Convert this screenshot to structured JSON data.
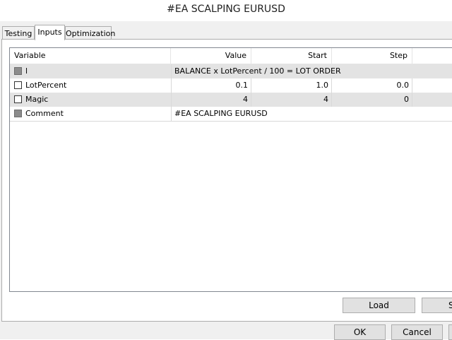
{
  "window": {
    "title": "#EA SCALPING EURUSD"
  },
  "tabs": [
    {
      "label": "Testing"
    },
    {
      "label": "Inputs",
      "active": true
    },
    {
      "label": "Optimization"
    }
  ],
  "grid": {
    "columns": [
      "Variable",
      "Value",
      "Start",
      "Step"
    ],
    "rows": [
      {
        "checked": "gray",
        "variable": "l",
        "value": "BALANCE x LotPercent / 100 = LOT ORDER",
        "start": "",
        "step": ""
      },
      {
        "checked": false,
        "variable": "LotPercent",
        "value": "0.1",
        "start": "1.0",
        "step": "0.0"
      },
      {
        "checked": false,
        "variable": "Magic",
        "value": "4",
        "start": "4",
        "step": "0"
      },
      {
        "checked": "gray",
        "variable": "Comment",
        "value": "#EA SCALPING EURUSD",
        "start": "",
        "step": ""
      }
    ]
  },
  "buttons": {
    "load": "Load",
    "save": "S",
    "ok": "OK",
    "cancel": "Cancel"
  }
}
